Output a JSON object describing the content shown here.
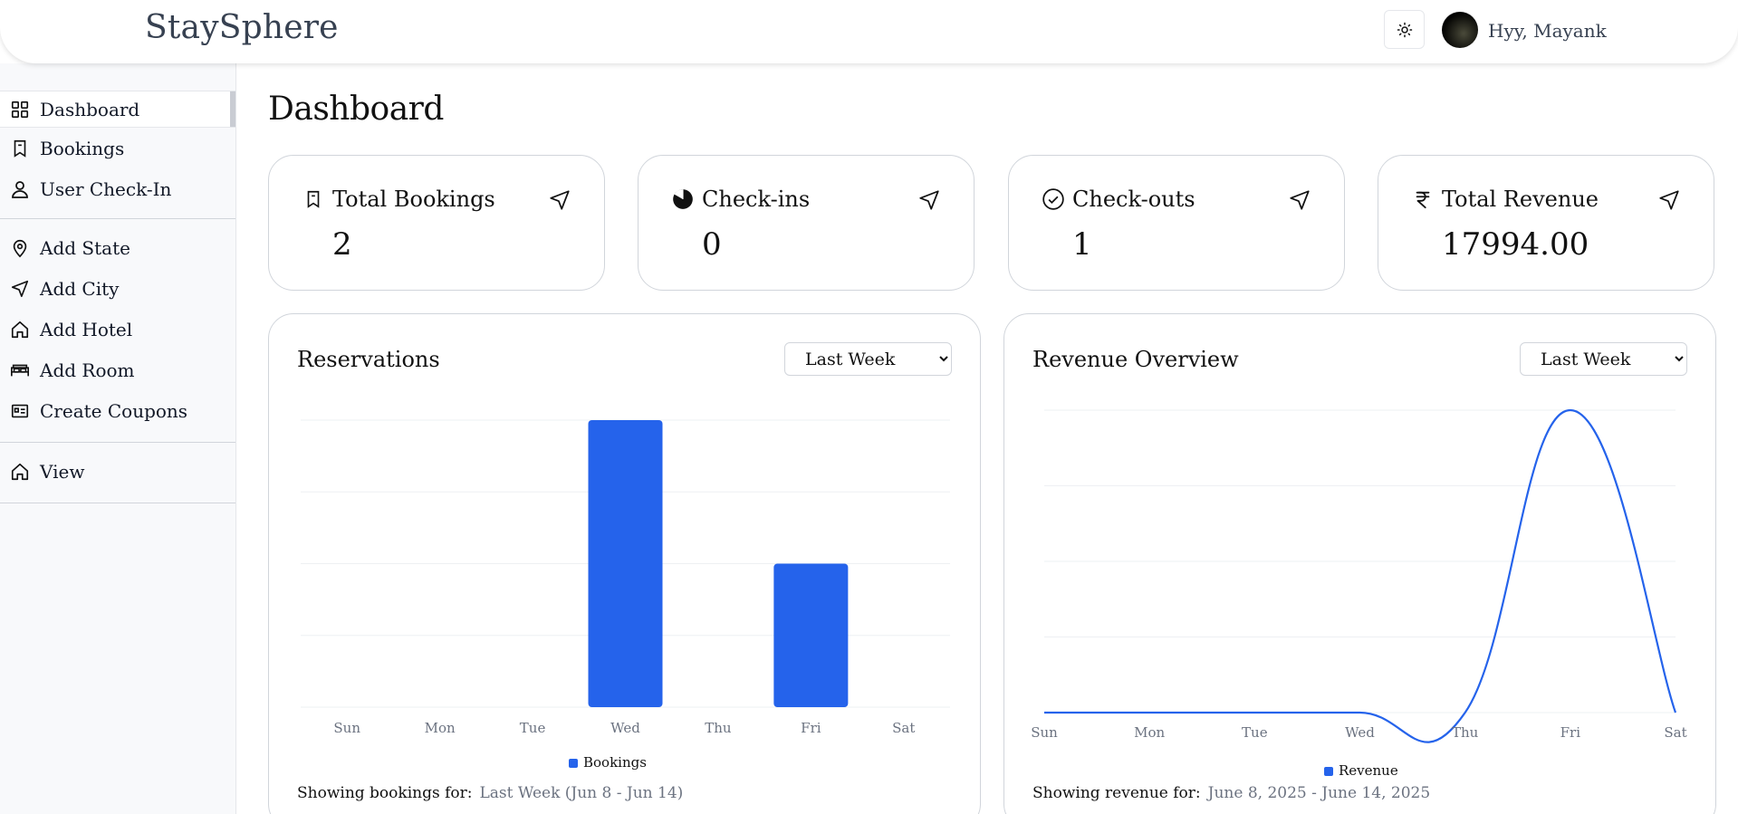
{
  "header": {
    "brand": "StaySphere",
    "greeting": "Hyy, Mayank"
  },
  "sidebar": {
    "groups": [
      [
        {
          "label": "Dashboard",
          "icon": "grid-icon",
          "active": true
        },
        {
          "label": "Bookings",
          "icon": "bookmark-icon"
        },
        {
          "label": "User Check-In",
          "icon": "user-icon"
        }
      ],
      [
        {
          "label": "Add State",
          "icon": "map-pin-icon"
        },
        {
          "label": "Add City",
          "icon": "send-icon"
        },
        {
          "label": "Add Hotel",
          "icon": "home-icon"
        },
        {
          "label": "Add Room",
          "icon": "bed-icon"
        },
        {
          "label": "Create Coupons",
          "icon": "id-card-icon"
        }
      ],
      [
        {
          "label": "View",
          "icon": "home-icon"
        }
      ]
    ]
  },
  "page_title": "Dashboard",
  "stats": [
    {
      "label": "Total Bookings",
      "value": "2",
      "icon": "bookmark-icon"
    },
    {
      "label": "Check-ins",
      "value": "0",
      "icon": "pie-icon"
    },
    {
      "label": "Check-outs",
      "value": "1",
      "icon": "check-circle-icon"
    },
    {
      "label": "Total Revenue",
      "value": "17994.00",
      "icon": "rupee-icon"
    }
  ],
  "reservations": {
    "title": "Reservations",
    "filter_value": "Last Week",
    "footer_label": "Showing bookings for:",
    "footer_value": "Last Week (Jun 8 - Jun 14)"
  },
  "revenue": {
    "title": "Revenue Overview",
    "filter_value": "Last Week",
    "footer_label": "Showing revenue for:",
    "footer_value": "June 8, 2025 - June 14, 2025"
  },
  "colors": {
    "accent": "#2563eb",
    "border": "#d1d5db",
    "sidebar_bg": "#f8f9fb"
  },
  "chart_data": [
    {
      "type": "bar",
      "categories": [
        "Sun",
        "Mon",
        "Tue",
        "Wed",
        "Thu",
        "Fri",
        "Sat"
      ],
      "series": [
        {
          "name": "Bookings",
          "values": [
            0,
            0,
            0,
            2,
            0,
            1,
            0
          ]
        }
      ],
      "ylim": [
        0,
        2
      ],
      "grid": true,
      "legend": "bottom"
    },
    {
      "type": "line",
      "categories": [
        "Sun",
        "Mon",
        "Tue",
        "Wed",
        "Thu",
        "Fri",
        "Sat"
      ],
      "series": [
        {
          "name": "Revenue",
          "values": [
            0,
            0,
            0,
            0,
            0,
            17994,
            0
          ]
        }
      ],
      "ylim": [
        0,
        17994
      ],
      "grid": true,
      "legend": "bottom"
    }
  ]
}
